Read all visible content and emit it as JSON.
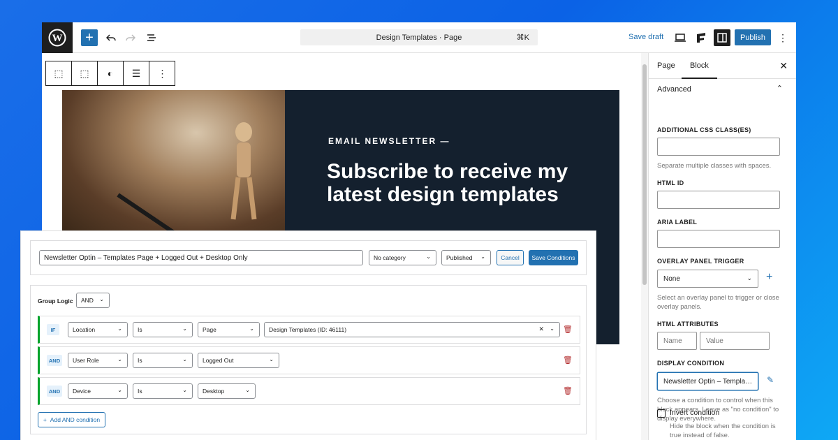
{
  "topbar": {
    "undo_icon": "undo-icon",
    "redo_icon": "redo-icon",
    "document_title": "Design Templates · Page",
    "shortcut": "⌘K",
    "save_draft": "Save draft",
    "publish": "Publish"
  },
  "hero": {
    "eyebrow": "EMAIL NEWSLETTER —",
    "headline": "Subscribe to receive my latest design templates"
  },
  "sidebar": {
    "tabs": [
      "Page",
      "Block"
    ],
    "section": "Advanced",
    "css_label": "ADDITIONAL CSS CLASS(ES)",
    "css_help": "Separate multiple classes with spaces.",
    "html_id_label": "HTML ID",
    "aria_label": "ARIA LABEL",
    "overlay_label": "OVERLAY PANEL TRIGGER",
    "overlay_value": "None",
    "overlay_help": "Select an overlay panel to trigger or close overlay panels.",
    "attr_label": "HTML ATTRIBUTES",
    "attr_name_ph": "Name",
    "attr_value_ph": "Value",
    "display_label": "DISPLAY CONDITION",
    "display_value": "Newsletter Optin – Templa…",
    "display_help": "Choose a condition to control when this block appears. Leave as \"no condition\" to display everywhere.",
    "invert_label": "Invert condition",
    "invert_help": "Hide the block when the condition is true instead of false."
  },
  "conditions": {
    "name": "Newsletter Optin – Templates Page + Logged Out + Desktop Only",
    "category": "No category",
    "status": "Published",
    "cancel": "Cancel",
    "save": "Save Conditions",
    "group_logic_label": "Group Logic",
    "group_logic": "AND",
    "rules": [
      {
        "badge": "IF",
        "field": "Location",
        "op": "Is",
        "type": "Page",
        "value": "Design Templates (ID: 46111)"
      },
      {
        "badge": "AND",
        "field": "User Role",
        "op": "Is",
        "value": "Logged Out"
      },
      {
        "badge": "AND",
        "field": "Device",
        "op": "Is",
        "value": "Desktop"
      }
    ],
    "add": "Add AND condition"
  }
}
